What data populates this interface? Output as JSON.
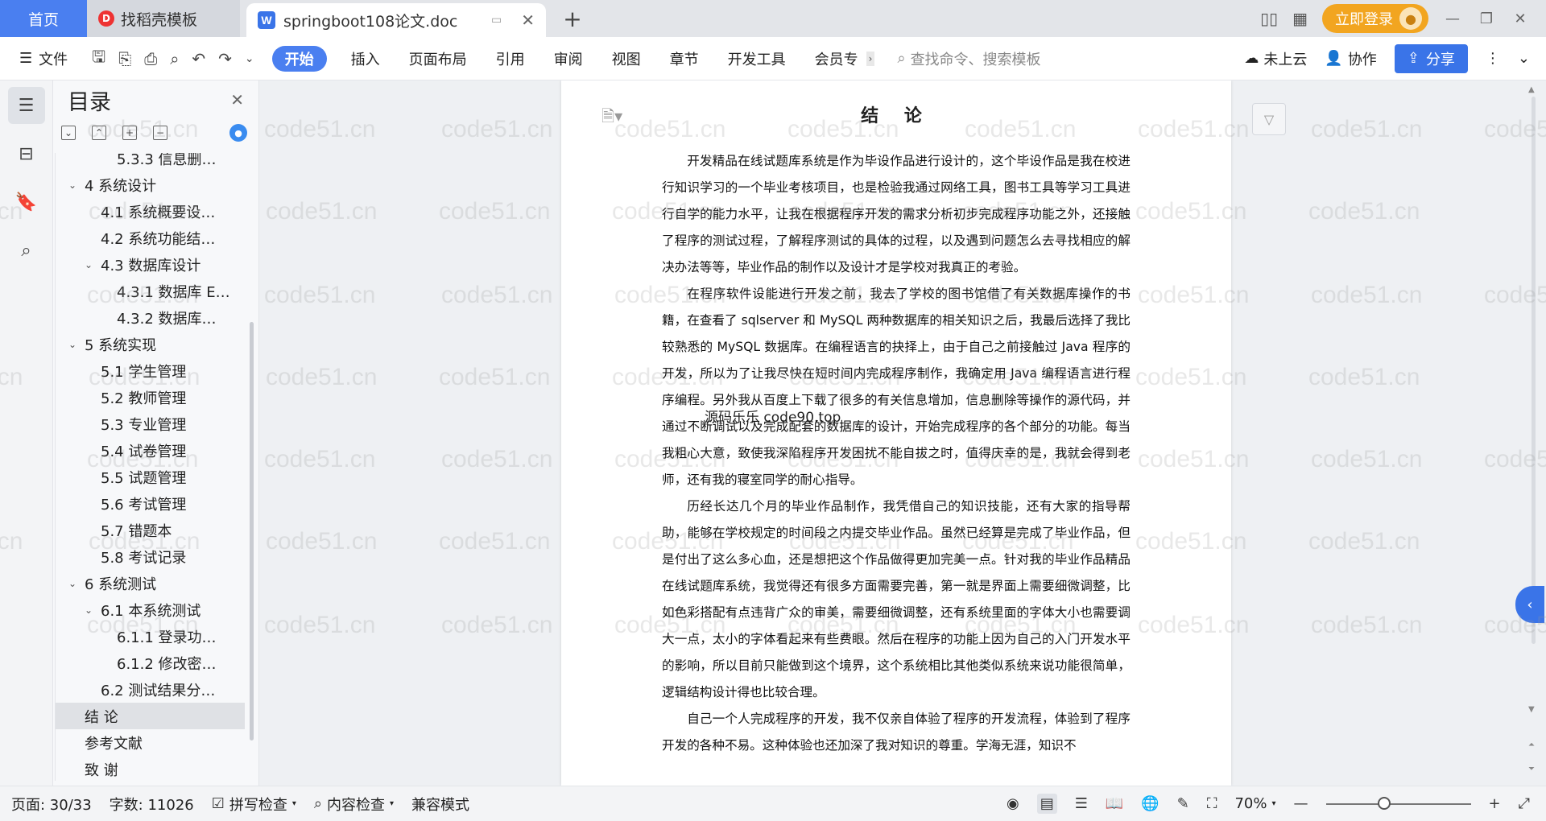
{
  "tabs": {
    "home": "首页",
    "daoke": "找稻壳模板",
    "doc": "springboot108论文.doc",
    "add": "+"
  },
  "titlebar": {
    "login": "立即登录"
  },
  "ribbon": {
    "file": "文件",
    "tabs": [
      "开始",
      "插入",
      "页面布局",
      "引用",
      "审阅",
      "视图",
      "章节",
      "开发工具",
      "会员专"
    ],
    "search_placeholder": "查找命令、搜索模板",
    "cloud": "未上云",
    "collab": "协作",
    "share": "分享"
  },
  "toc": {
    "title": "目录",
    "items": [
      {
        "label": "5.3.3 信息删…",
        "level": 3,
        "caret": ""
      },
      {
        "label": "4  系统设计",
        "level": 1,
        "caret": "v"
      },
      {
        "label": "4.1 系统概要设…",
        "level": 2,
        "caret": ""
      },
      {
        "label": "4.2 系统功能结…",
        "level": 2,
        "caret": ""
      },
      {
        "label": "4.3 数据库设计",
        "level": 2,
        "caret": "v"
      },
      {
        "label": "4.3.1 数据库 E…",
        "level": 3,
        "caret": ""
      },
      {
        "label": "4.3.2  数据库…",
        "level": 3,
        "caret": ""
      },
      {
        "label": "5  系统实现",
        "level": 1,
        "caret": "v"
      },
      {
        "label": "5.1  学生管理",
        "level": 2,
        "caret": ""
      },
      {
        "label": "5.2  教师管理",
        "level": 2,
        "caret": ""
      },
      {
        "label": "5.3  专业管理",
        "level": 2,
        "caret": ""
      },
      {
        "label": "5.4  试卷管理",
        "level": 2,
        "caret": ""
      },
      {
        "label": "5.5  试题管理",
        "level": 2,
        "caret": ""
      },
      {
        "label": "5.6  考试管理",
        "level": 2,
        "caret": ""
      },
      {
        "label": "5.7  错题本",
        "level": 2,
        "caret": ""
      },
      {
        "label": "5.8  考试记录",
        "level": 2,
        "caret": ""
      },
      {
        "label": "6 系统测试",
        "level": 1,
        "caret": "v"
      },
      {
        "label": "6.1  本系统测试",
        "level": 2,
        "caret": "v"
      },
      {
        "label": "6.1.1 登录功…",
        "level": 3,
        "caret": ""
      },
      {
        "label": "6.1.2 修改密…",
        "level": 3,
        "caret": ""
      },
      {
        "label": "6.2 测试结果分…",
        "level": 2,
        "caret": ""
      },
      {
        "label": "结  论",
        "level": 1,
        "caret": "",
        "selected": true
      },
      {
        "label": "参考文献",
        "level": 1,
        "caret": ""
      },
      {
        "label": "致  谢",
        "level": 1,
        "caret": ""
      }
    ]
  },
  "document": {
    "title": "结 论",
    "overlay": "源码乐乐 code90.top",
    "paragraphs": [
      "开发精品在线试题库系统是作为毕设作品进行设计的，这个毕设作品是我在校进行知识学习的一个毕业考核项目，也是检验我通过网络工具，图书工具等学习工具进行自学的能力水平，让我在根据程序开发的需求分析初步完成程序功能之外，还接触了程序的测试过程，了解程序测试的具体的过程，以及遇到问题怎么去寻找相应的解决办法等等，毕业作品的制作以及设计才是学校对我真正的考验。",
      "在程序软件设能进行开发之前，我去了学校的图书馆借了有关数据库操作的书籍，在查看了 sqlserver 和 MySQL 两种数据库的相关知识之后，我最后选择了我比较熟悉的 MySQL 数据库。在编程语言的抉择上，由于自己之前接触过 Java 程序的开发，所以为了让我尽快在短时间内完成程序制作，我确定用 Java 编程语言进行程序编程。另外我从百度上下载了很多的有关信息增加，信息删除等操作的源代码，并通过不断调试以及完成配套的数据库的设计，开始完成程序的各个部分的功能。每当我粗心大意，致使我深陷程序开发困扰不能自拔之时，值得庆幸的是，我就会得到老师，还有我的寝室同学的耐心指导。",
      "历经长达几个月的毕业作品制作，我凭借自己的知识技能，还有大家的指导帮助，能够在学校规定的时间段之内提交毕业作品。虽然已经算是完成了毕业作品，但是付出了这么多心血，还是想把这个作品做得更加完美一点。针对我的毕业作品精品在线试题库系统，我觉得还有很多方面需要完善，第一就是界面上需要细微调整，比如色彩搭配有点违背广众的审美，需要细微调整，还有系统里面的字体大小也需要调大一点，太小的字体看起来有些费眼。然后在程序的功能上因为自己的入门开发水平的影响，所以目前只能做到这个境界，这个系统相比其他类似系统来说功能很简单，逻辑结构设计得也比较合理。",
      "自己一个人完成程序的开发，我不仅亲自体验了程序的开发流程，体验到了程序开发的各种不易。这种体验也还加深了我对知识的尊重。学海无涯，知识不"
    ]
  },
  "watermark": "code51.cn",
  "statusbar": {
    "page": "页面: 30/33",
    "words": "字数: 11026",
    "spell": "拼写检查",
    "content": "内容检查",
    "compat": "兼容模式",
    "zoom": "70%",
    "zoom_fraction": 0.4
  }
}
